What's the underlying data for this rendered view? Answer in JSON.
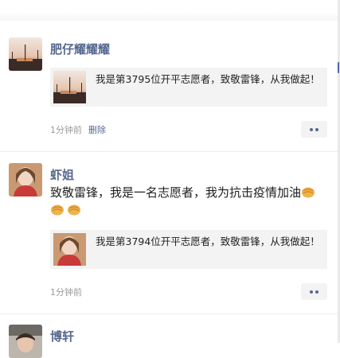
{
  "feed": {
    "posts": [
      {
        "author": "肥仔耀耀耀",
        "text": "",
        "share": {
          "title": "我是第3795位开平志愿者，致敬雷锋，从我做起！"
        },
        "time": "1分钟前",
        "delete_label": "删除",
        "avatar_icon": "sunset-landscape-avatar",
        "thumb_icon": "sunset-landscape-thumbnail"
      },
      {
        "author": "虾姐",
        "text": "致敬雷锋，我是一名志愿者，我为抗击疫情加油",
        "emojis": [
          "fist-emoji",
          "fist-emoji",
          "fist-emoji"
        ],
        "share": {
          "title": "我是第3794位开平志愿者，致敬雷锋，从我做起！"
        },
        "time": "1分钟前",
        "avatar_icon": "woman-portrait-avatar",
        "thumb_icon": "woman-portrait-thumbnail"
      },
      {
        "author": "博轩",
        "avatar_icon": "person-avatar"
      }
    ]
  }
}
